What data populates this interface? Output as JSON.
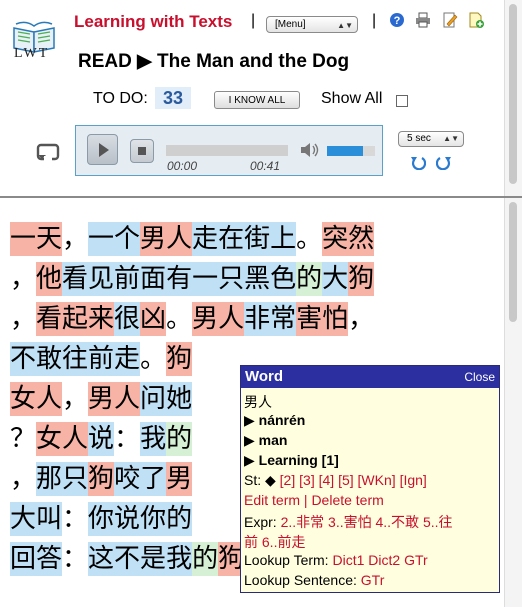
{
  "header": {
    "logo_text": "LWT",
    "app_title": "Learning with Texts",
    "separator": "|",
    "menu_label": "[Menu]",
    "read_title": "READ ▶ The Man and the Dog",
    "todo_label": "TO DO:",
    "todo_count": "33",
    "iknow_label": "I KNOW ALL",
    "show_all_label": "Show All"
  },
  "audio": {
    "current_time": "00:00",
    "total_time": "00:41",
    "seek_step": "5 sec",
    "volume_level": 0.75
  },
  "text_lines": [
    [
      [
        "一天",
        "s1"
      ],
      [
        "，",
        "p"
      ],
      [
        "一个",
        "s2"
      ],
      [
        "男人",
        "s1"
      ],
      [
        "走",
        "s2"
      ],
      [
        "在",
        "s2"
      ],
      [
        "街上",
        "s2"
      ],
      [
        "。",
        "p"
      ],
      [
        "突然",
        "s1"
      ]
    ],
    [
      [
        "，",
        "p"
      ],
      [
        "他",
        "s1"
      ],
      [
        "看见",
        "s2"
      ],
      [
        "前面",
        "s2"
      ],
      [
        "有",
        "s2"
      ],
      [
        "一只",
        "s2"
      ],
      [
        "黑色",
        "s2"
      ],
      [
        "的",
        "s4"
      ],
      [
        "大",
        "s2"
      ],
      [
        "狗",
        "s1"
      ]
    ],
    [
      [
        "，",
        "p"
      ],
      [
        "看起来",
        "s1"
      ],
      [
        "很",
        "s2"
      ],
      [
        "凶",
        "s1"
      ],
      [
        "。",
        "p"
      ],
      [
        "男人",
        "s1"
      ],
      [
        "非常",
        "s2"
      ],
      [
        "害怕",
        "s1"
      ],
      [
        "，",
        "p"
      ]
    ],
    [
      [
        "不敢",
        "s2"
      ],
      [
        "往",
        "s2"
      ],
      [
        "前",
        "s2"
      ],
      [
        "走",
        "s2"
      ],
      [
        "。",
        "p"
      ],
      [
        "狗",
        "s1"
      ]
    ],
    [
      [
        "女人",
        "s1"
      ],
      [
        "，",
        "p"
      ],
      [
        "男人",
        "s1"
      ],
      [
        "问",
        "s2"
      ],
      [
        "她",
        "s2"
      ]
    ],
    [
      [
        "？",
        "p"
      ],
      [
        "女人",
        "s1"
      ],
      [
        "说",
        "s2"
      ],
      [
        "：",
        "p"
      ],
      [
        "我",
        "s2"
      ],
      [
        "的",
        "s4"
      ]
    ],
    [
      [
        "，",
        "p"
      ],
      [
        "那",
        "s2"
      ],
      [
        "只",
        "s2"
      ],
      [
        "狗",
        "s1"
      ],
      [
        "咬了",
        "s2"
      ],
      [
        "男",
        "s1"
      ]
    ],
    [
      [
        "大叫",
        "s2"
      ],
      [
        "：",
        "p"
      ],
      [
        "你",
        "s2"
      ],
      [
        "说",
        "s2"
      ],
      [
        "你的",
        "s2"
      ]
    ],
    [
      [
        "回答",
        "s2"
      ],
      [
        "：",
        "p"
      ],
      [
        "这",
        "s2"
      ],
      [
        "不是",
        "s2"
      ],
      [
        "我",
        "s2"
      ],
      [
        "的",
        "s4"
      ],
      [
        "狗",
        "s1"
      ],
      [
        "。",
        "p"
      ]
    ]
  ],
  "popup": {
    "title": "Word",
    "close_label": "Close",
    "term": "男人",
    "romanization": "nánrén",
    "translation": "man",
    "status_name": "Learning [1]",
    "status_prefix": "St: ◆",
    "status_links": [
      "[2]",
      "[3]",
      "[4]",
      "[5]",
      "[WKn]",
      "[Ign]"
    ],
    "edit_term": "Edit term",
    "pipe": "|",
    "delete_term": "Delete term",
    "expr_label": "Expr:",
    "expressions_line1": "2..非常 3..害怕 4..不敢 5..往",
    "expressions_line2": "前 6..前走",
    "lookup_term_label": "Lookup Term:",
    "lookup_term_links": [
      "Dict1",
      "Dict2",
      "GTr"
    ],
    "lookup_sentence_label": "Lookup Sentence:",
    "lookup_sentence_link": "GTr"
  },
  "colors": {
    "status_1": "#f6b3a6",
    "status_2": "#bfe0f5",
    "status_4": "#d5f0d5",
    "title_red": "#c8102e",
    "popup_header": "#2b2fa0",
    "popup_bg": "#ffffe0"
  }
}
